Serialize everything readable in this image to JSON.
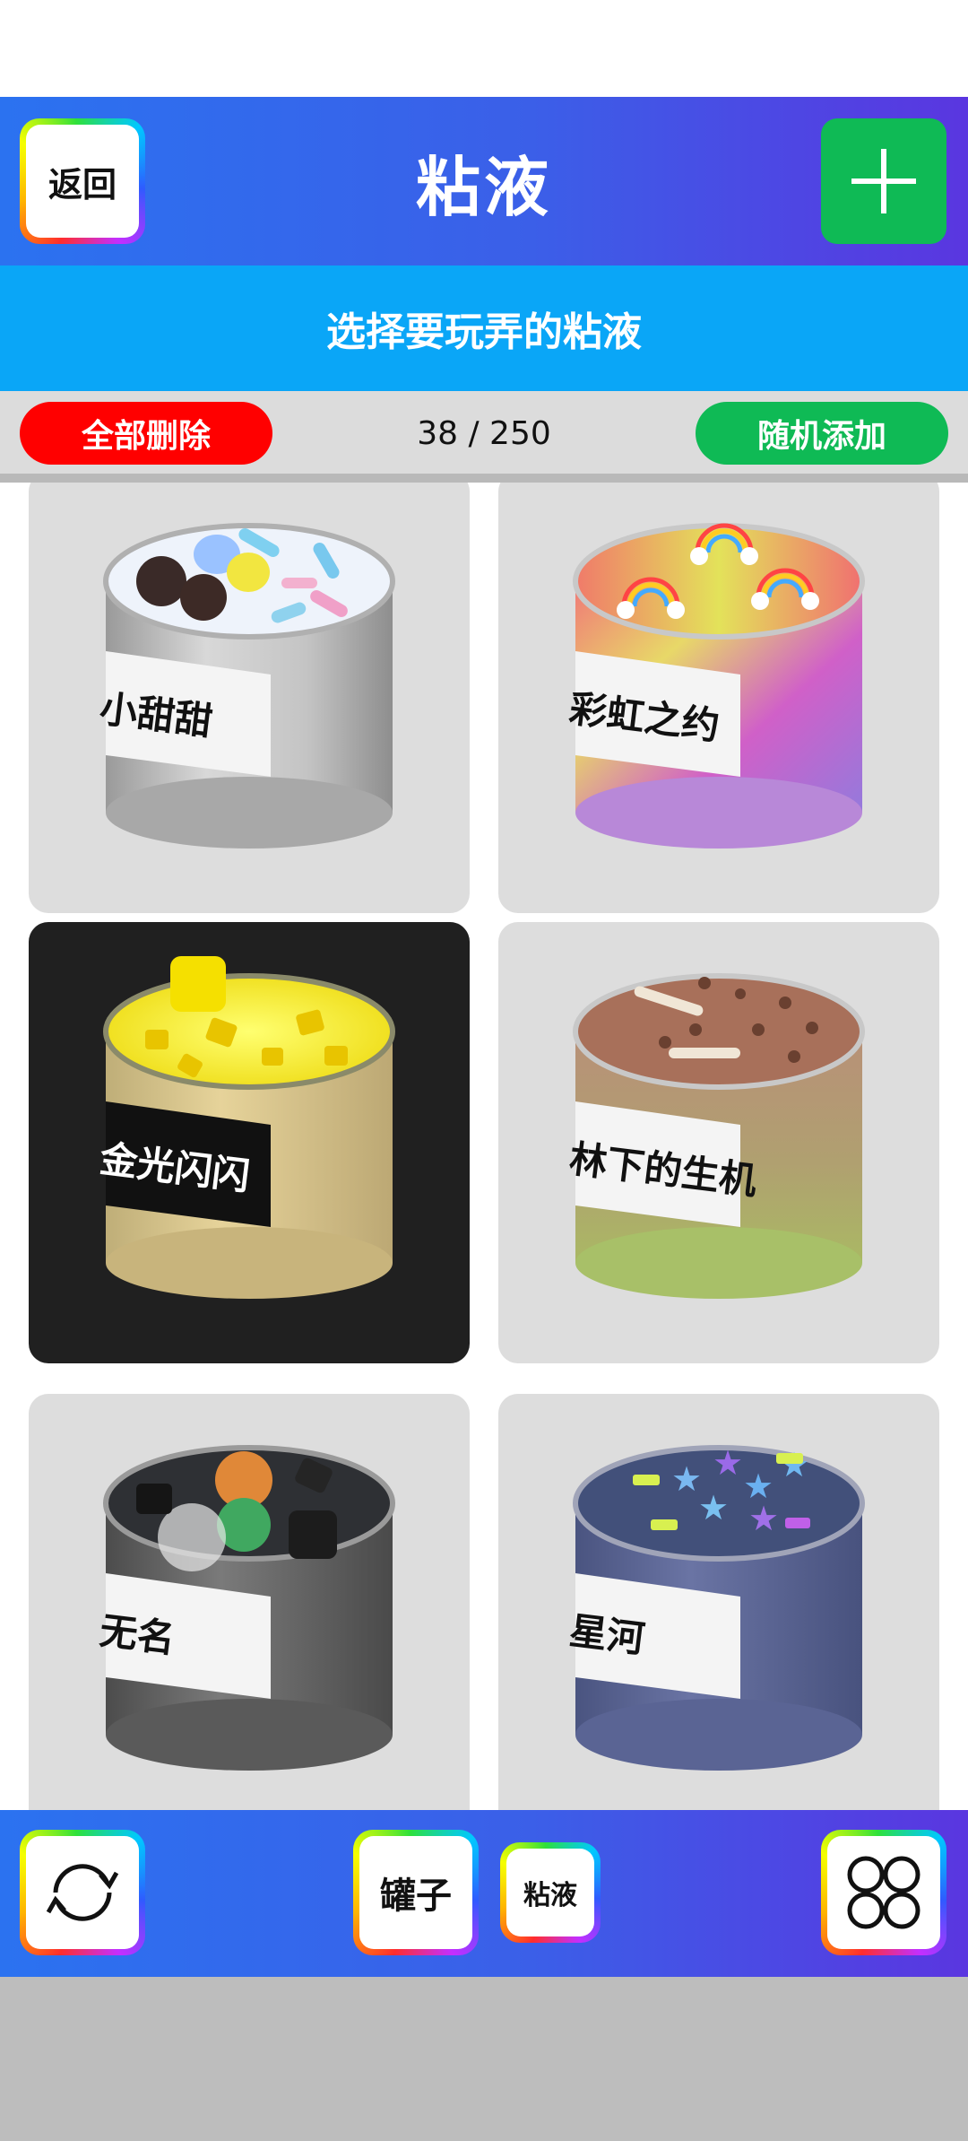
{
  "header": {
    "back_label": "返回",
    "title": "粘液",
    "add_icon": "plus-icon"
  },
  "subtitle": "选择要玩弄的粘液",
  "toolbar": {
    "delete_all_label": "全部删除",
    "count_text": "38 / 250",
    "random_add_label": "随机添加"
  },
  "slimes": [
    {
      "name": "小甜甜"
    },
    {
      "name": "彩虹之约"
    },
    {
      "name": "金光闪闪"
    },
    {
      "name": "林下的生机"
    },
    {
      "name": "无名"
    },
    {
      "name": "星河"
    }
  ],
  "bottom_bar": {
    "refresh_icon": "refresh-icon",
    "jar_label": "罐子",
    "slime_label": "粘液",
    "menu_icon": "grid-menu-icon"
  },
  "colors": {
    "header_start": "#2b72f0",
    "header_end": "#5a36e0",
    "subtitle_bg": "#0aa6f7",
    "delete": "#ff0000",
    "random": "#0fba55"
  }
}
